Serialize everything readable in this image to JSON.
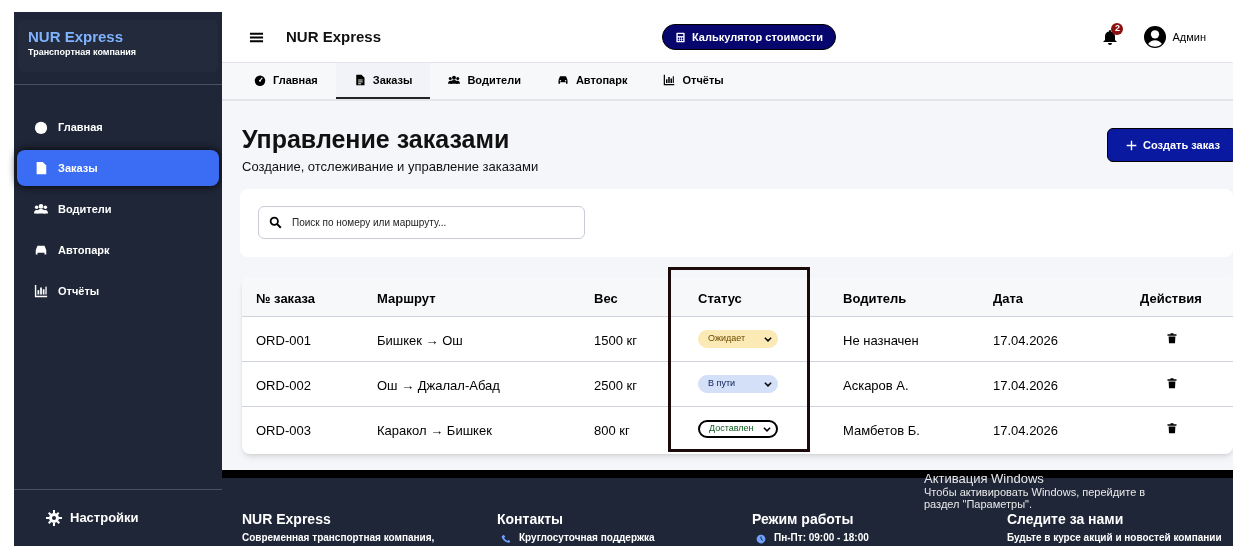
{
  "sidebar": {
    "brand": "NUR Express",
    "tagline": "Транспортная компания",
    "items": [
      {
        "label": "Главная",
        "selected": false
      },
      {
        "label": "Заказы",
        "selected": true
      },
      {
        "label": "Водители",
        "selected": false
      },
      {
        "label": "Автопарк",
        "selected": false
      },
      {
        "label": "Отчёты",
        "selected": false
      }
    ],
    "settings": "Настройки"
  },
  "header": {
    "title": "NUR Express",
    "calculator": "Калькулятор стоимости",
    "notifications": "2",
    "user": "Админ"
  },
  "tabs": [
    {
      "label": "Главная",
      "selected": false
    },
    {
      "label": "Заказы",
      "selected": true
    },
    {
      "label": "Водители",
      "selected": false
    },
    {
      "label": "Автопарк",
      "selected": false
    },
    {
      "label": "Отчёты",
      "selected": false
    }
  ],
  "page": {
    "title": "Управление заказами",
    "subtitle": "Создание, отслеживание и управление заказами",
    "create_button": "Создать заказ"
  },
  "search": {
    "placeholder": "Поиск по номеру или маршруту..."
  },
  "table": {
    "columns": [
      "№ заказа",
      "Маршрут",
      "Вес",
      "Статус",
      "Водитель",
      "Дата",
      "Действия"
    ],
    "status_column_framed": true,
    "rows": [
      {
        "id": "ORD-001",
        "route": "Бишкек → Ош",
        "weight": "1500 кг",
        "status": {
          "label": "Ожидает",
          "kind": "pending"
        },
        "driver": "Не назначен",
        "date": "17.04.2026"
      },
      {
        "id": "ORD-002",
        "route": "Ош → Джалал-Абад",
        "weight": "2500 кг",
        "status": {
          "label": "В пути",
          "kind": "transit"
        },
        "driver": "Аскаров А.",
        "date": "17.04.2026"
      },
      {
        "id": "ORD-003",
        "route": "Каракол → Бишкек",
        "weight": "800 кг",
        "status": {
          "label": "Доставлен",
          "kind": "delivered"
        },
        "driver": "Мамбетов Б.",
        "date": "17.04.2026"
      }
    ]
  },
  "footer": {
    "columns": [
      {
        "title": "NUR Express",
        "lines": [
          {
            "text": "Современная транспортная компания,",
            "kind": "text"
          }
        ]
      },
      {
        "title": "Контакты",
        "lines": [
          {
            "text": "Круглосуточная поддержка",
            "kind": "phone"
          }
        ]
      },
      {
        "title": "Режим работы",
        "lines": [
          {
            "text": "Пн-Пт: 09:00 - 18:00",
            "kind": "hours"
          }
        ]
      },
      {
        "title": "Следите за нами",
        "lines": [
          {
            "text": "Будьте в курсе акций и новостей компании",
            "kind": "text"
          }
        ]
      }
    ]
  },
  "os_notice": {
    "title": "Активация Windows",
    "lines": [
      "Чтобы активировать Windows, перейдите в",
      "раздел \"Параметры\"."
    ]
  }
}
